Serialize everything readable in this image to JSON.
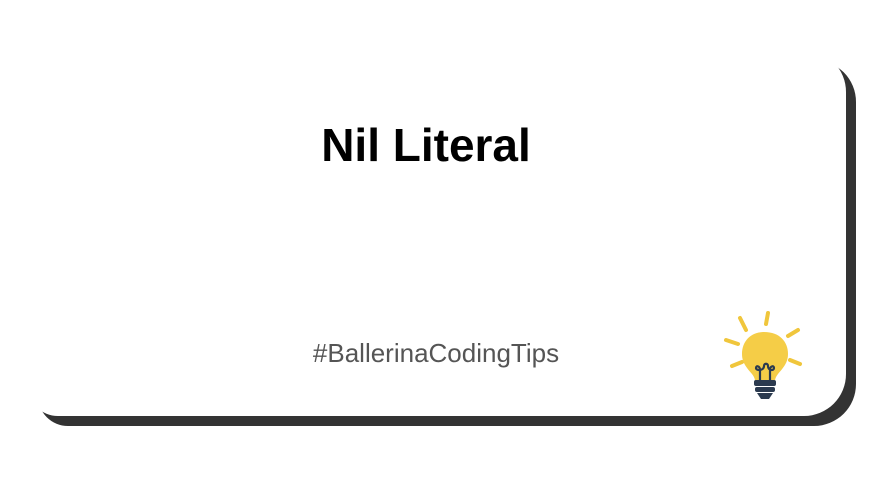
{
  "slide": {
    "title": "Nil Literal",
    "hashtag": "#BallerinaCodingTips",
    "icon": "lightbulb-icon"
  },
  "colors": {
    "card_background": "#ffffff",
    "card_shadow": "#333333",
    "title_text": "#000000",
    "hashtag_text": "#555555",
    "bulb_glass": "#f5cd47",
    "bulb_base": "#2b3a4f",
    "bulb_rays": "#f0c63c"
  }
}
